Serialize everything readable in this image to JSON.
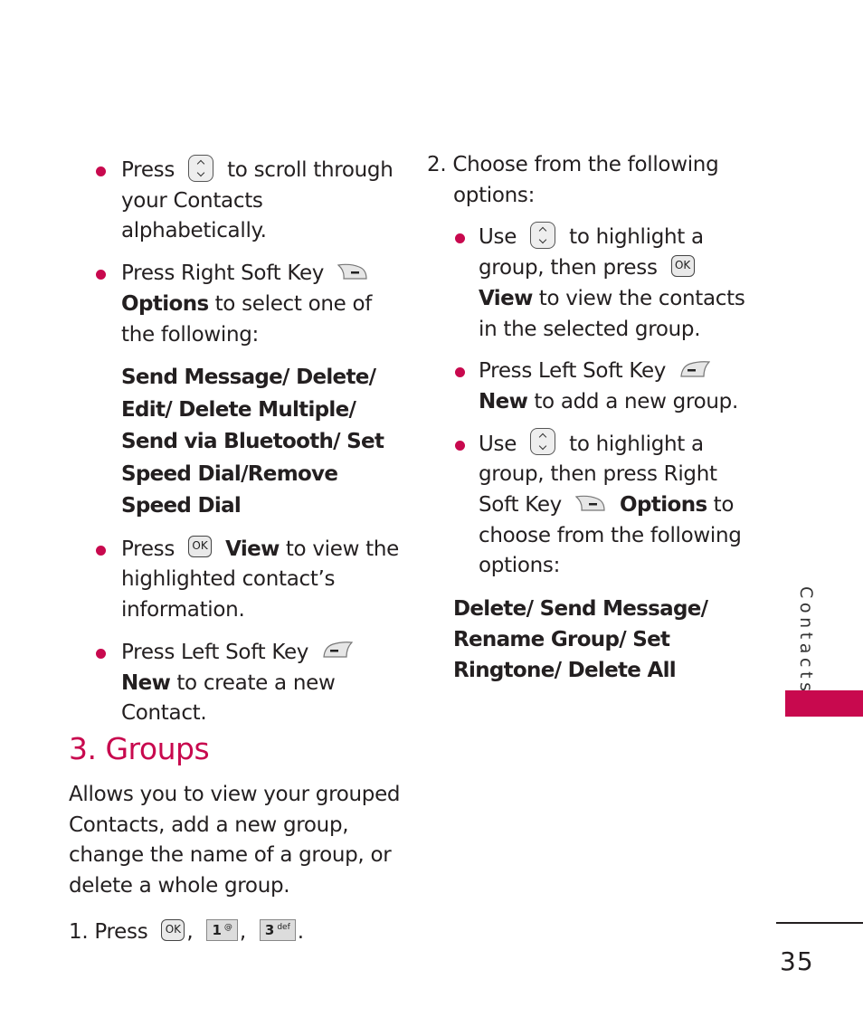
{
  "section_tab": {
    "label": "Contacts",
    "accent_color": "#c8094e"
  },
  "page_number": "35",
  "left_column": {
    "bullets": [
      {
        "pre": "Press",
        "icon": "nav-key-up-down-icon",
        "post": "to scroll through your Contacts alphabetically."
      },
      {
        "pre": "Press Right Soft Key",
        "icon": "right-soft-key-icon",
        "bold": "Options",
        "post": "to select one of the following:"
      },
      {
        "pre": "Press",
        "icon": "ok-key-icon",
        "bold": "View",
        "post": "to view the highlighted contact’s information."
      },
      {
        "pre": "Press Left Soft Key",
        "icon": "left-soft-key-icon",
        "bold": "New",
        "post": "to create a new Contact."
      }
    ],
    "options_list": "Send Message/ Delete/ Edit/ Delete Multiple/ Send via Bluetooth/ Set Speed Dial/Remove Speed Dial"
  },
  "groups_section": {
    "heading": "3. Groups",
    "description": "Allows you to view your grouped Contacts, add a new group, change the name of a group, or delete a whole group.",
    "step1": {
      "prefix": "1. Press",
      "keys": [
        {
          "label": "OK"
        },
        {
          "label": "1",
          "sub": "@"
        },
        {
          "label": "3",
          "sub": "def"
        }
      ],
      "sep": ",",
      "end": "."
    }
  },
  "right_column": {
    "step2": "2. Choose from the following options:",
    "bullets": [
      {
        "pre": "Use",
        "icon": "nav-key-up-down-icon",
        "mid": "to highlight a group, then press",
        "icon2": "ok-key-icon",
        "bold": "View",
        "post": "to view the contacts in the selected group."
      },
      {
        "pre": "Press Left Soft Key",
        "icon": "left-soft-key-icon",
        "bold": "New",
        "post": "to add a new group."
      },
      {
        "pre": "Use",
        "icon": "nav-key-up-down-icon",
        "mid": "to highlight a group, then press Right Soft Key",
        "icon2": "right-soft-key-icon",
        "bold": "Options",
        "post": "to choose from the following options:"
      }
    ],
    "options_list": "Delete/ Send Message/ Rename Group/ Set Ringtone/ Delete All"
  }
}
